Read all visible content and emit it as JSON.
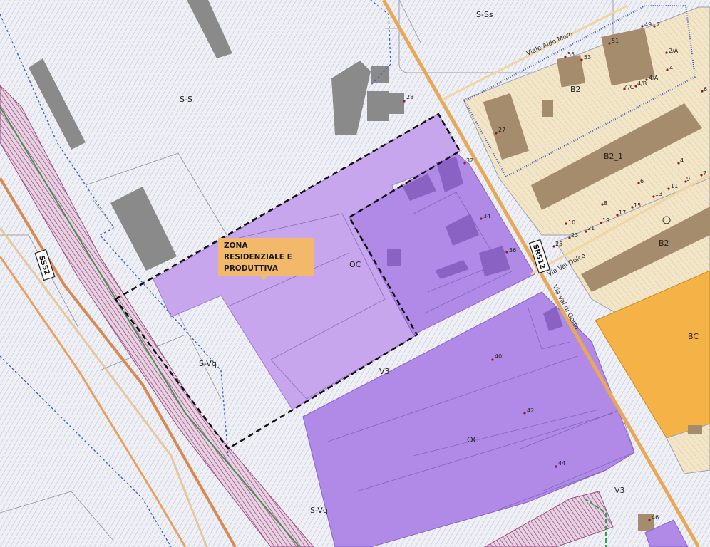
{
  "colors": {
    "background": "#eef0f6",
    "oc_zone": "#b08ae6",
    "oc_zone_light": "#c7a6ee",
    "b2_zone": "#f3e6c8",
    "bc_zone": "#f5b347",
    "road": "#f2c27c",
    "building_gray": "#8a8a8a",
    "building_brown": "#a58c6c",
    "callout_bg": "#f2b96a",
    "rail_hatch": "#9a4d86",
    "dashed_boundary": "#111111"
  },
  "callout": {
    "line1": "ZONA",
    "line2": "RESIDENZIALE E",
    "line3": "PRODUTTIVA"
  },
  "zone_labels": {
    "s_ss": "S-Ss",
    "s_s": "S-S",
    "b2_top": "B2",
    "b2_1": "B2_1",
    "b2_right": "B2",
    "bc": "BC",
    "oc_top": "OC",
    "oc_bottom": "OC",
    "v3_mid": "V3",
    "v3_bottom": "V3",
    "s_vq_left": "S-Vq",
    "s_vq_bottom": "S-Vq"
  },
  "road_labels": {
    "viale_aldo_moro": "Viale Aldo Moro",
    "via_val_dolce": "Via Val Dolce",
    "via_val_di_gorto": "Via Val di Gorto",
    "sr512": "SR512",
    "ss52": "SS52"
  },
  "house_numbers": {
    "n28": "28",
    "n32": "32",
    "n34": "34",
    "n36": "36",
    "n40": "40",
    "n42": "42",
    "n44": "44",
    "n46": "46",
    "n27": "27",
    "n55": "55",
    "n53": "53",
    "n51": "51",
    "n49": "49",
    "n2": "2",
    "n2a": "2/A",
    "n4": "4",
    "n4a": "4/A",
    "n4b": "4/B",
    "n4c": "4/C",
    "n6": "6",
    "n4_r": "4",
    "n6_r": "6",
    "n7": "7",
    "n8": "8",
    "n9": "9",
    "n10": "10",
    "n11": "11",
    "n13": "13",
    "n15": "15",
    "n17": "17",
    "n19": "19",
    "n21": "21",
    "n23": "23",
    "n25": "25"
  }
}
